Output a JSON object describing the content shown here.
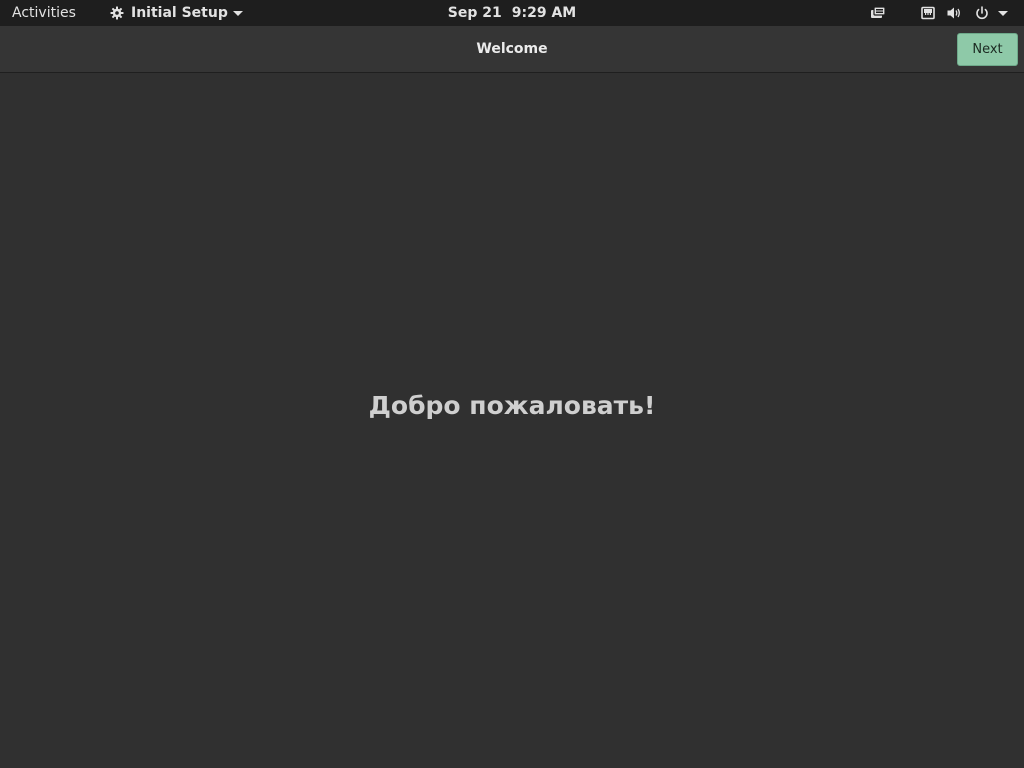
{
  "top_panel": {
    "activities_label": "Activities",
    "app_menu": {
      "icon": "gear-icon",
      "label": "Initial Setup"
    },
    "clock": {
      "date": "Sep 21",
      "time": "9:29 AM"
    },
    "tray_icons": [
      "accessibility-icon",
      "network-wired-icon",
      "volume-icon",
      "power-icon",
      "system-menu-caret-icon"
    ]
  },
  "header_bar": {
    "title": "Welcome",
    "next_label": "Next",
    "next_color": "#8ec9a8"
  },
  "main": {
    "welcome_text": "Добро пожаловать!"
  },
  "colors": {
    "panel_bg": "#1e1e1e",
    "header_bg": "#353535",
    "content_bg": "#303030"
  }
}
